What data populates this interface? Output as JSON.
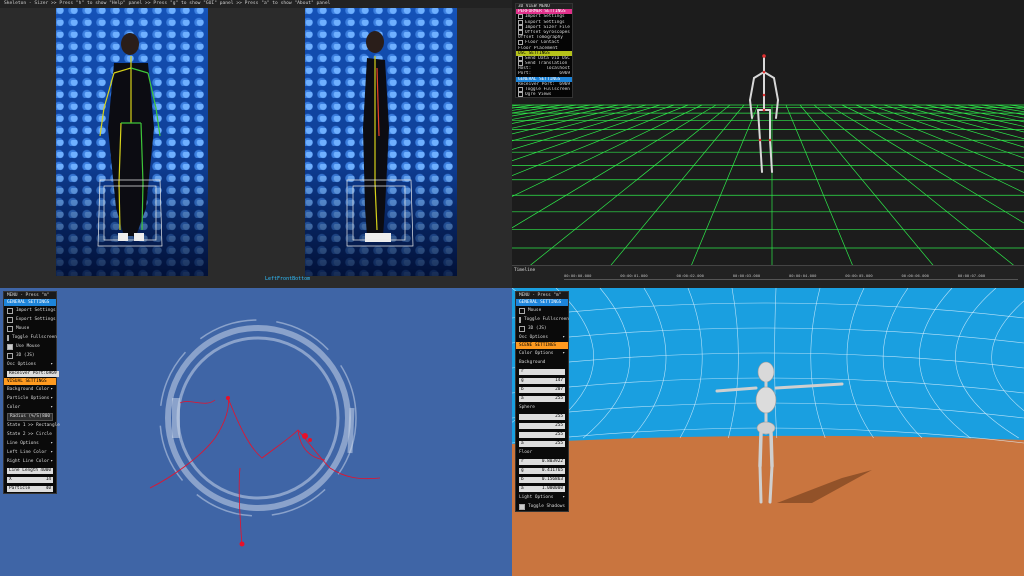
{
  "q1": {
    "topbar_text": "Skeleton - Sizer >> Press \"h\" to show \"Help\" panel >> Press \"g\" to show \"GUI\" panel >> Press \"a\" to show \"About\" panel",
    "corner_label": "LeftFrontBottom"
  },
  "q2": {
    "menu": {
      "title": "3D VIEW MENU",
      "sections": [
        {
          "header": "PERFORMER SETTINGS",
          "style": "pink"
        },
        {
          "label": "Import Settings",
          "checkbox": true
        },
        {
          "label": "Export Settings",
          "checkbox": true
        },
        {
          "label": "Import Sizer File",
          "checkbox": true
        },
        {
          "label": "Offset Gyroscopes",
          "checkbox": true
        },
        {
          "label": "Offset Tomography",
          "checkbox": false
        },
        {
          "label": "Floor Contact",
          "checkbox": true
        },
        {
          "label": "Floor Placement",
          "checkbox": false
        },
        {
          "header": "OSC SETTINGS",
          "style": "yellow"
        },
        {
          "label": "Send Data via OSC",
          "checkbox": true
        },
        {
          "label": "Send Translation",
          "checkbox": true
        },
        {
          "label": "Host:",
          "value": "localhost"
        },
        {
          "label": "Port:",
          "value": "6969"
        },
        {
          "header": "GENERAL SETTINGS",
          "style": "blue"
        },
        {
          "label": "Receiver Port:",
          "value": "6969"
        },
        {
          "label": "Toggle Fullscreen",
          "checkbox": true
        },
        {
          "label": "Ogre Views",
          "checkbox": true
        }
      ]
    },
    "timeline": {
      "label": "Timeline",
      "ticks": [
        "00:00:00.000",
        "00:00:01.000",
        "00:00:02.000",
        "00:00:03.000",
        "00:00:04.000",
        "00:00:05.000",
        "00:00:06.000",
        "00:00:07.000"
      ]
    },
    "colors": {
      "grid": "#2ee84a",
      "floor": "#101010"
    }
  },
  "q3": {
    "panel": {
      "title": "MENU - Press \"m\"",
      "rows": [
        {
          "type": "header",
          "label": "GENERAL SETTINGS",
          "style": "blue"
        },
        {
          "type": "check",
          "label": "Import Settings",
          "on": false
        },
        {
          "type": "check",
          "label": "Export Settings",
          "on": false
        },
        {
          "type": "check",
          "label": "Mouse",
          "on": false
        },
        {
          "type": "check",
          "label": "Toggle Fullscreen",
          "on": true
        },
        {
          "type": "check",
          "label": "Use Mouse",
          "on": true
        },
        {
          "type": "check",
          "label": "3D (JS)",
          "on": false
        },
        {
          "type": "group",
          "label": "Osc Options"
        },
        {
          "type": "field",
          "label": "Receiver Port:",
          "value": "6969"
        },
        {
          "type": "header",
          "label": "VISUAL SETTINGS",
          "style": "orange"
        },
        {
          "type": "group",
          "label": "Background Color"
        },
        {
          "type": "group",
          "label": "Particle Options"
        },
        {
          "type": "group",
          "label": "Color"
        },
        {
          "type": "field",
          "label": "Radius (%/S)",
          "value": "800",
          "dark": true
        },
        {
          "type": "plain",
          "label": "State 1 >> Rectangle"
        },
        {
          "type": "plain",
          "label": "State 2 >> Circle"
        },
        {
          "type": "group",
          "label": "Line Options"
        },
        {
          "type": "group",
          "label": "Left Line Color"
        },
        {
          "type": "group",
          "label": "Right Line Color"
        },
        {
          "type": "field",
          "label": "Line Length",
          "value": "4000"
        },
        {
          "type": "field",
          "label": "X",
          "value": "14"
        },
        {
          "type": "field",
          "label": "Particle",
          "value": "40"
        }
      ]
    },
    "colors": {
      "ring": "#c9d6ea",
      "trail": "#e8102a"
    }
  },
  "q4": {
    "panel": {
      "title": "MENU - Press \"m\"",
      "rows": [
        {
          "type": "header",
          "label": "GENERAL SETTINGS",
          "style": "blue"
        },
        {
          "type": "check",
          "label": "Mouse",
          "on": false
        },
        {
          "type": "check",
          "label": "Toggle Fullscreen",
          "on": false
        },
        {
          "type": "check",
          "label": "3D (JS)",
          "on": false
        },
        {
          "type": "group",
          "label": "Osc Options"
        },
        {
          "type": "header",
          "label": "SCENE SETTINGS",
          "style": "orange"
        },
        {
          "type": "group",
          "label": "Color Options"
        },
        {
          "type": "plain",
          "label": "Background"
        },
        {
          "type": "field",
          "label": "r",
          "value": ""
        },
        {
          "type": "field",
          "label": "g",
          "value": "147"
        },
        {
          "type": "field",
          "label": "b",
          "value": "207"
        },
        {
          "type": "field",
          "label": "a",
          "value": "255"
        },
        {
          "type": "plain",
          "label": "Sphere"
        },
        {
          "type": "field",
          "label": "",
          "value": "255"
        },
        {
          "type": "field",
          "label": "",
          "value": "255"
        },
        {
          "type": "field",
          "label": "",
          "value": "255"
        },
        {
          "type": "field",
          "label": "a",
          "value": "255"
        },
        {
          "type": "plain",
          "label": "Floor"
        },
        {
          "type": "field",
          "label": "r",
          "value": "0.803922"
        },
        {
          "type": "field",
          "label": "g",
          "value": "0.411765"
        },
        {
          "type": "field",
          "label": "b",
          "value": "0.156863"
        },
        {
          "type": "field",
          "label": "a",
          "value": "1.000000"
        },
        {
          "type": "group",
          "label": "Light Options"
        },
        {
          "type": "check",
          "label": "Toggle Shadows",
          "on": true
        }
      ]
    },
    "colors": {
      "sky": "#1a9fe0",
      "floor": "#c9753f",
      "bone": "#cfcfcf"
    }
  }
}
